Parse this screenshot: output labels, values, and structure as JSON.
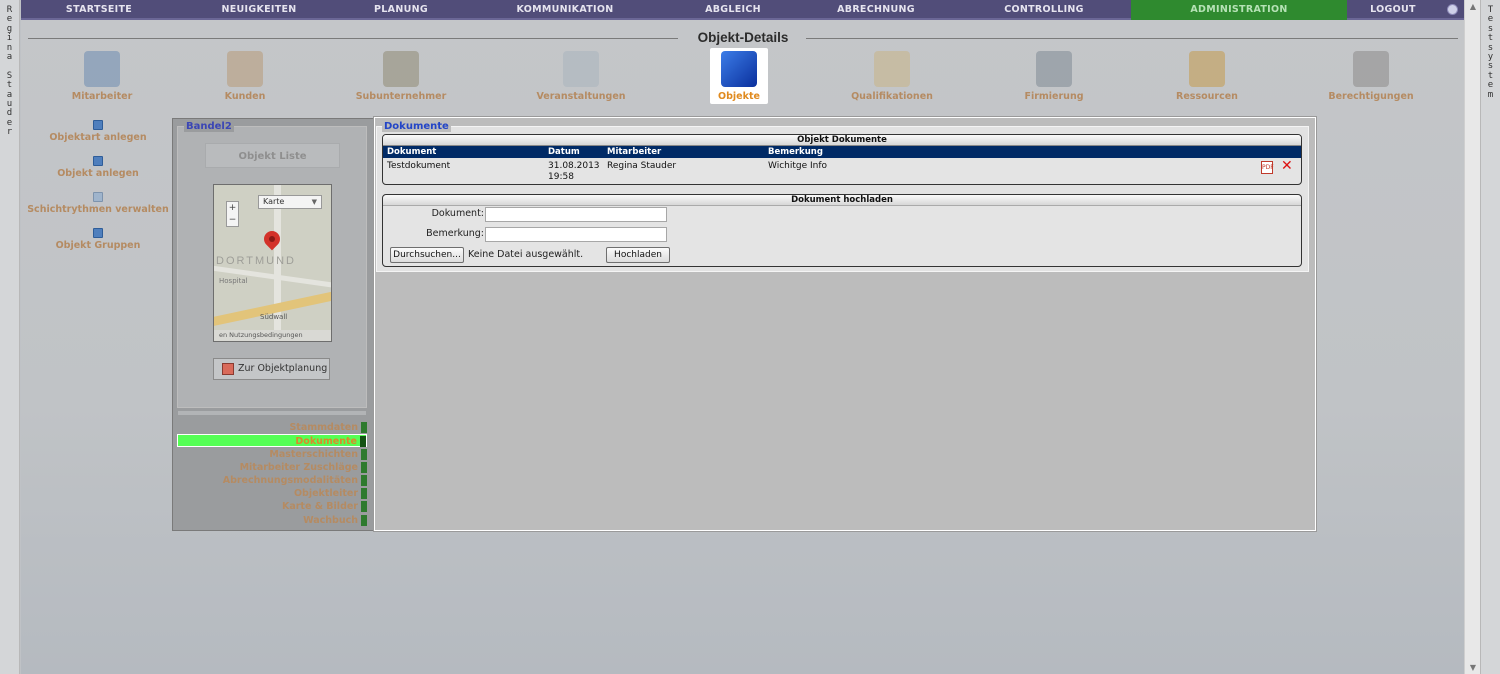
{
  "side_left": {
    "chars": [
      "R",
      "e",
      "g",
      "i",
      "n",
      "a",
      "",
      "S",
      "t",
      "a",
      "u",
      "d",
      "e",
      "r"
    ]
  },
  "side_right": {
    "chars": [
      "T",
      "e",
      "s",
      "t",
      "s",
      "y",
      "s",
      "t",
      "e",
      "m"
    ]
  },
  "nav": {
    "items": [
      "STARTSEITE",
      "NEUIGKEITEN",
      "PLANUNG",
      "KOMMUNIKATION",
      "ABGLEICH",
      "ABRECHNUNG",
      "CONTROLLING",
      "ADMINISTRATION",
      "LOGOUT"
    ],
    "active": "ADMINISTRATION"
  },
  "page_title": "Objekt-Details",
  "modules": [
    {
      "label": "Mitarbeiter",
      "icon": "employees-icon"
    },
    {
      "label": "Kunden",
      "icon": "handshake-icon"
    },
    {
      "label": "Subunternehmer",
      "icon": "subcontractor-icon"
    },
    {
      "label": "Veranstaltungen",
      "icon": "events-icon"
    },
    {
      "label": "Objekte",
      "icon": "cube-icon",
      "active": true
    },
    {
      "label": "Qualifikationen",
      "icon": "certificate-icon"
    },
    {
      "label": "Firmierung",
      "icon": "phone-icon"
    },
    {
      "label": "Ressourcen",
      "icon": "boxes-icon"
    },
    {
      "label": "Berechtigungen",
      "icon": "permissions-icon"
    }
  ],
  "left_menu": [
    "Objektart anlegen",
    "Objekt anlegen",
    "Schichtrythmen verwalten",
    "Objekt Gruppen"
  ],
  "object": {
    "name": "Bandel2",
    "list_button": "Objekt Liste",
    "map": {
      "type": "Karte",
      "city": "DORTMUND",
      "hospital": "Hospital",
      "street": "Südwall",
      "terms": "en  Nutzungsbedingungen",
      "zoom_in": "+",
      "zoom_out": "−"
    },
    "planning_button": "Zur Objektplanung"
  },
  "tabs": [
    "Stammdaten",
    "Dokumente",
    "Masterschichten",
    "Mitarbeiter Zuschläge",
    "Abrechnungsmodalitäten",
    "Objektleiter",
    "Karte & Bilder",
    "Wachbuch"
  ],
  "active_tab": "Dokumente",
  "documents": {
    "legend": "Dokumente",
    "table_caption": "Objekt Dokumente",
    "columns": [
      "Dokument",
      "Datum",
      "Mitarbeiter",
      "Bemerkung"
    ],
    "rows": [
      {
        "dokument": "Testdokument",
        "datum": "31.08.2013",
        "zeit": "19:58",
        "mitarbeiter": "Regina Stauder",
        "bemerkung": "Wichitge Info"
      }
    ]
  },
  "upload": {
    "caption": "Dokument hochladen",
    "label_document": "Dokument:",
    "label_remark": "Bemerkung:",
    "value_document": "",
    "value_remark": "",
    "browse_button": "Durchsuchen...",
    "no_file_text": "Keine Datei ausgewählt.",
    "upload_button": "Hochladen"
  },
  "colors": {
    "nav_bg": "#514d79",
    "active_nav": "#2f8a2f",
    "active_tab": "#55ff55",
    "table_header": "#002a66",
    "label_brown": "#b58b62"
  }
}
